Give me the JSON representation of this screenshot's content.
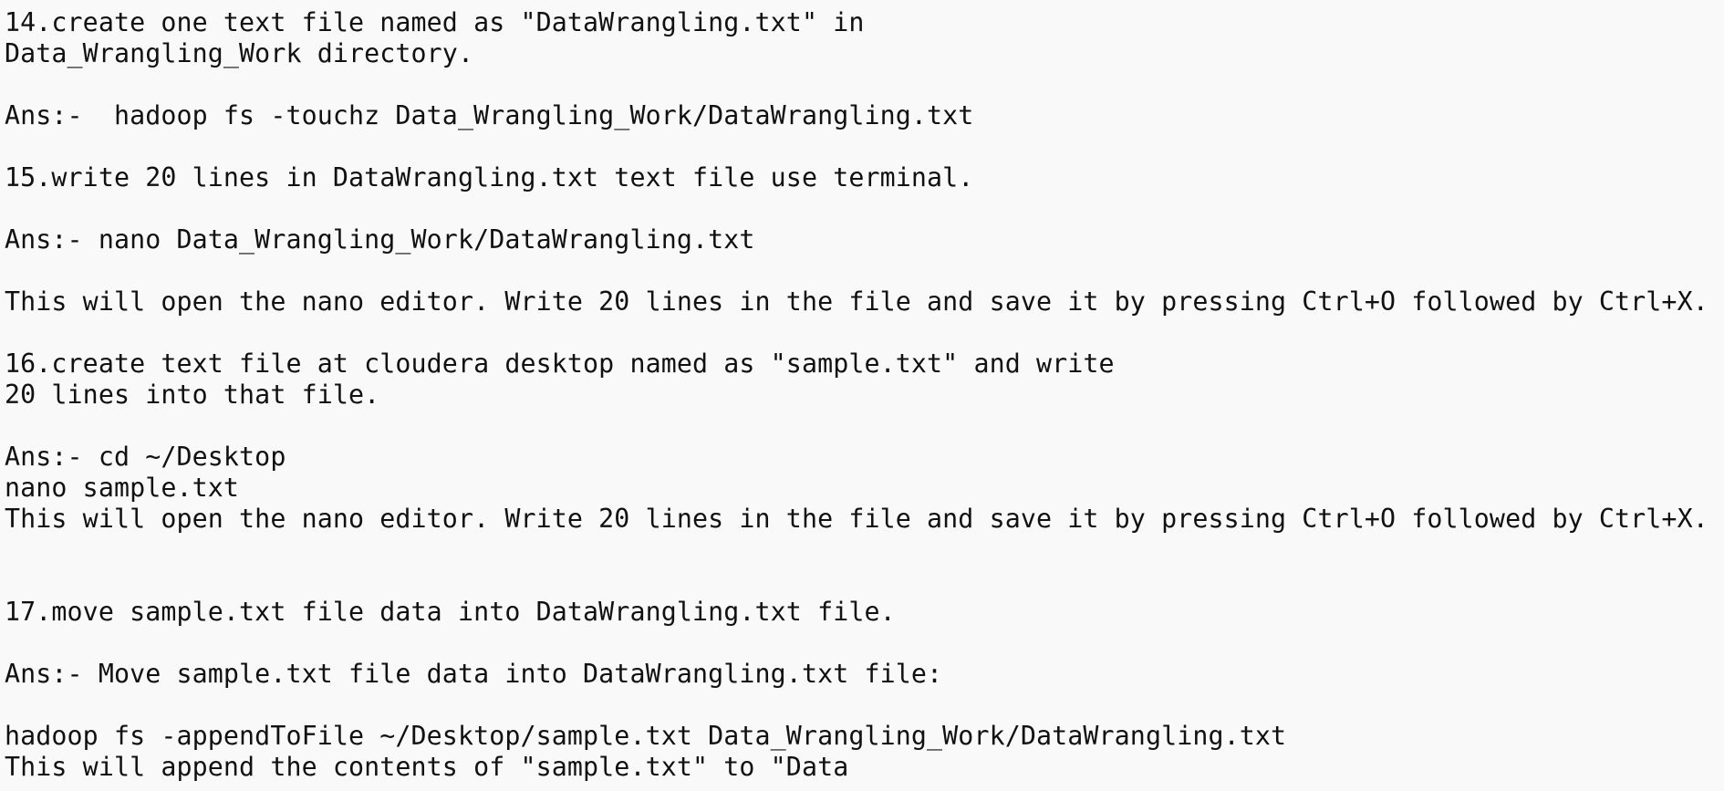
{
  "document": {
    "lines": [
      "14.create one text file named as \"DataWrangling.txt\" in",
      "Data_Wrangling_Work directory.",
      "",
      "Ans:-  hadoop fs -touchz Data_Wrangling_Work/DataWrangling.txt",
      "",
      "15.write 20 lines in DataWrangling.txt text file use terminal.",
      "",
      "Ans:- nano Data_Wrangling_Work/DataWrangling.txt",
      "",
      "This will open the nano editor. Write 20 lines in the file and save it by pressing Ctrl+O followed by Ctrl+X.",
      "",
      "16.create text file at cloudera desktop named as \"sample.txt\" and write",
      "20 lines into that file.",
      "",
      "Ans:- cd ~/Desktop",
      "nano sample.txt",
      "This will open the nano editor. Write 20 lines in the file and save it by pressing Ctrl+O followed by Ctrl+X.",
      "",
      "",
      "17.move sample.txt file data into DataWrangling.txt file.",
      "",
      "Ans:- Move sample.txt file data into DataWrangling.txt file:",
      "",
      "hadoop fs -appendToFile ~/Desktop/sample.txt Data_Wrangling_Work/DataWrangling.txt",
      "This will append the contents of \"sample.txt\" to \"Data"
    ]
  }
}
